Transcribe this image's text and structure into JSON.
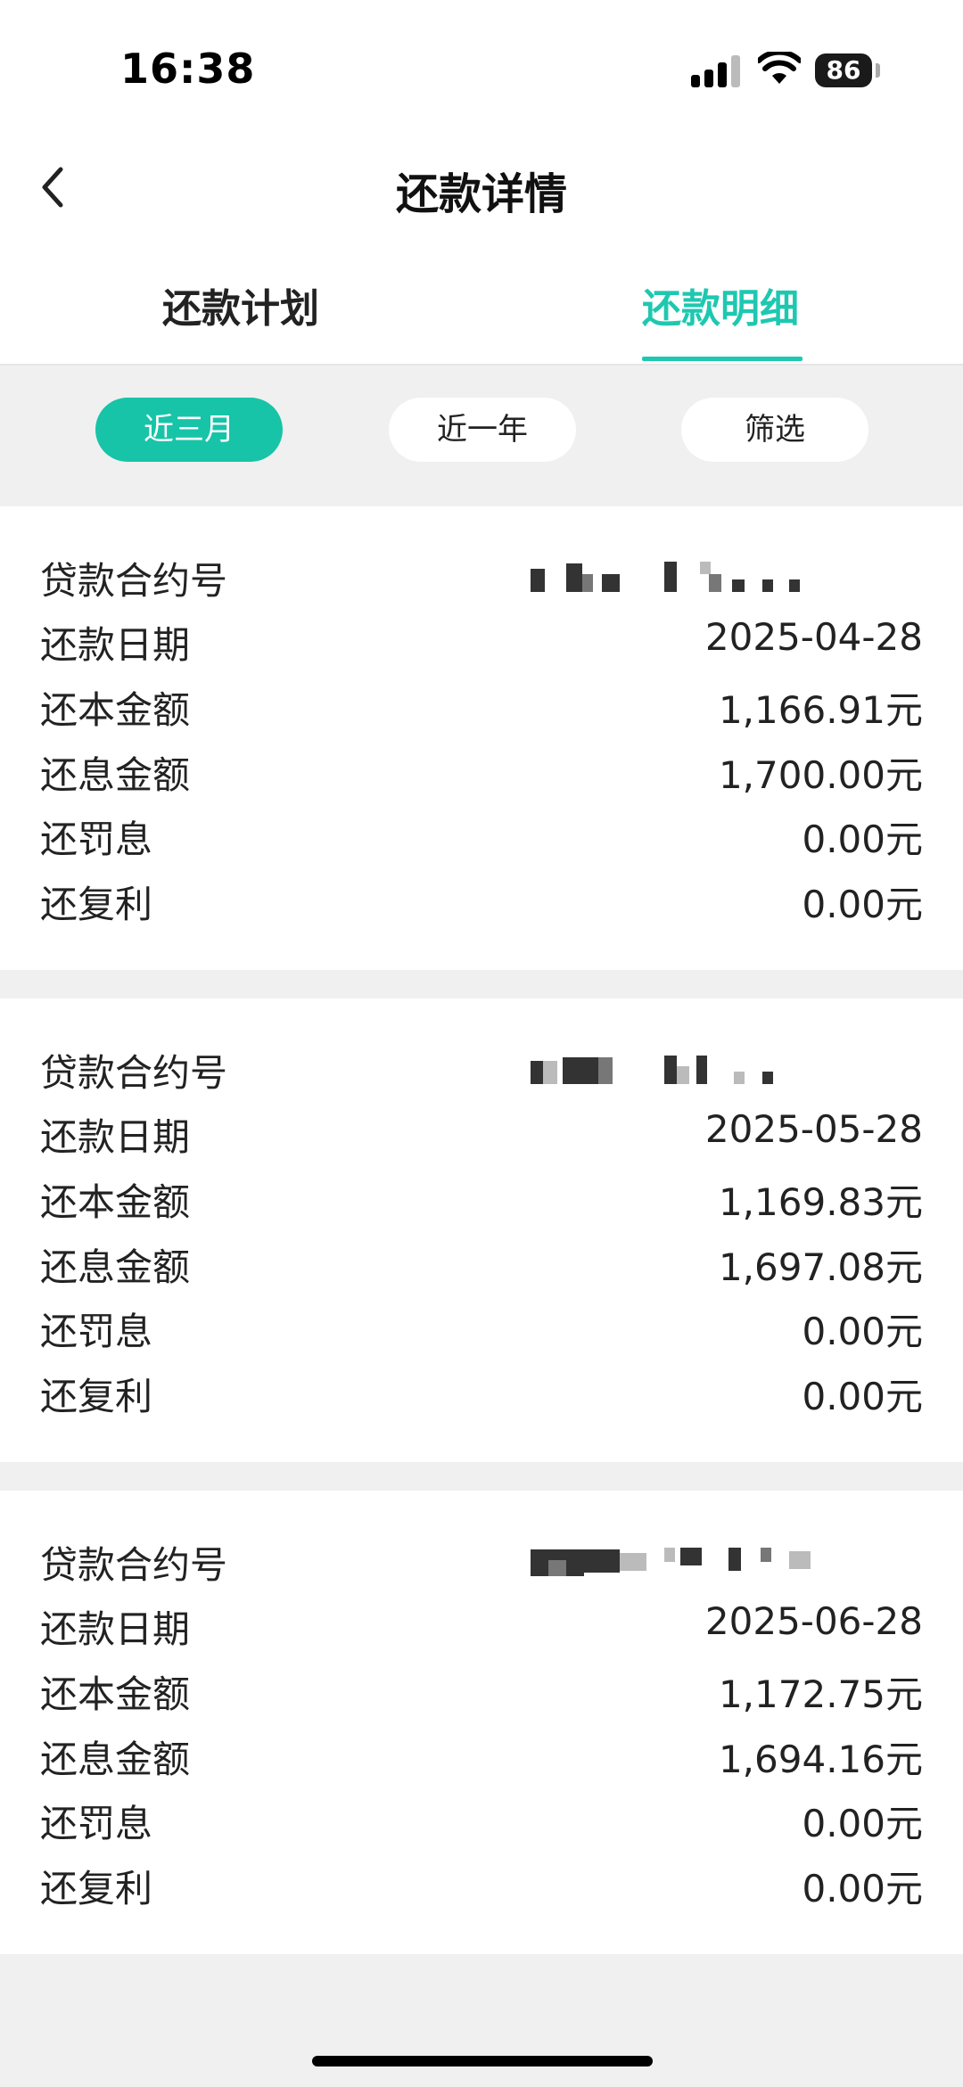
{
  "status_bar": {
    "time": "16:38",
    "battery": "86"
  },
  "nav": {
    "title": "还款详情"
  },
  "tabs": [
    {
      "label": "还款计划",
      "active": false
    },
    {
      "label": "还款明细",
      "active": true
    }
  ],
  "filters": [
    {
      "label": "近三月",
      "active": true
    },
    {
      "label": "近一年",
      "active": false
    },
    {
      "label": "筛选",
      "active": false
    }
  ],
  "field_labels": {
    "contract": "贷款合约号",
    "date": "还款日期",
    "principal": "还本金额",
    "interest": "还息金额",
    "penalty": "还罚息",
    "compound": "还复利"
  },
  "records": [
    {
      "contract": "",
      "date": "2025-04-28",
      "principal": "1,166.91元",
      "interest": "1,700.00元",
      "penalty": "0.00元",
      "compound": "0.00元"
    },
    {
      "contract": "",
      "date": "2025-05-28",
      "principal": "1,169.83元",
      "interest": "1,697.08元",
      "penalty": "0.00元",
      "compound": "0.00元"
    },
    {
      "contract": "",
      "date": "2025-06-28",
      "principal": "1,172.75元",
      "interest": "1,694.16元",
      "penalty": "0.00元",
      "compound": "0.00元"
    }
  ],
  "colors": {
    "accent": "#1ec8b0",
    "pill_active": "#17c4a8",
    "background": "#f0f0f0"
  }
}
